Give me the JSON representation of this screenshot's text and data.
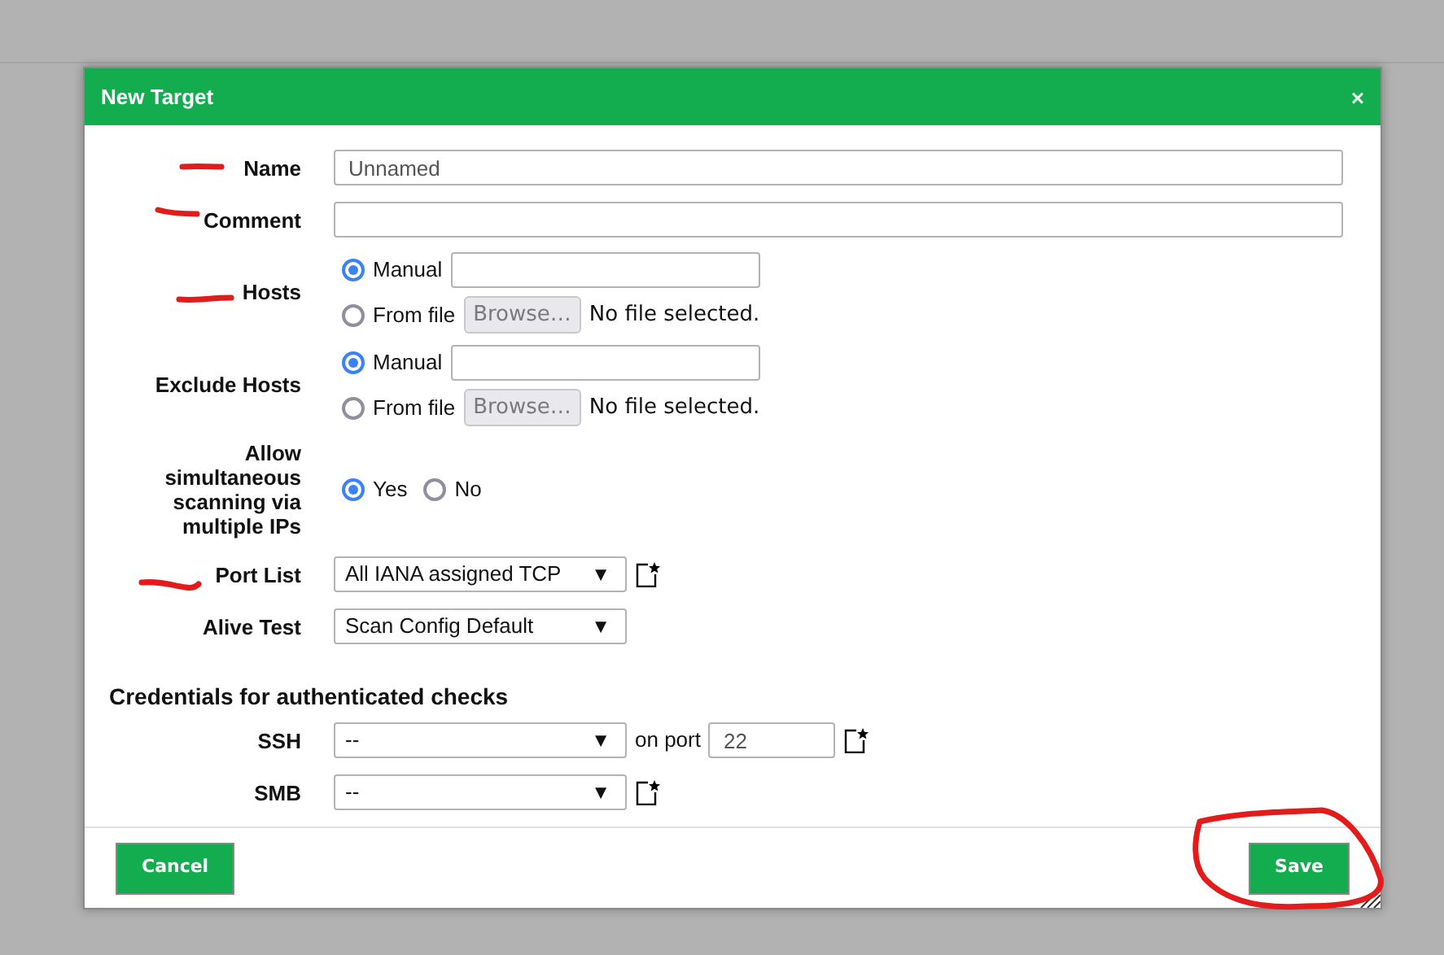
{
  "dialog": {
    "title": "New Target",
    "close": "×"
  },
  "rows": [
    {
      "kind": "text",
      "label": "Name",
      "value": "Unnamed"
    },
    {
      "kind": "text",
      "label": "Comment"
    },
    {
      "kind": "source",
      "label": "Hosts",
      "options": [
        {
          "label": "Manual",
          "selected": true,
          "kind": "input"
        },
        {
          "label": "From file",
          "selected": false,
          "kind": "file",
          "button": "Browse…",
          "status": "No file selected."
        }
      ]
    },
    {
      "kind": "source",
      "label": "Exclude Hosts",
      "options": [
        {
          "label": "Manual",
          "selected": true,
          "kind": "input"
        },
        {
          "label": "From file",
          "selected": false,
          "kind": "file",
          "button": "Browse…",
          "status": "No file selected."
        }
      ]
    },
    {
      "kind": "choice",
      "label": "Allow simultaneous scanning via multiple IPs",
      "options": [
        {
          "label": "Yes",
          "selected": true
        },
        {
          "label": "No",
          "selected": false
        }
      ]
    },
    {
      "kind": "select",
      "label": "Port List",
      "value": "All IANA assigned TCP",
      "caret": "▼",
      "new_icon": true
    },
    {
      "kind": "select",
      "label": "Alive Test",
      "value": "Scan Config Default",
      "caret": "▼",
      "new_icon": false
    }
  ],
  "credentials": {
    "heading": "Credentials for authenticated checks",
    "rows": [
      {
        "label": "SSH",
        "value": "--",
        "caret": "▼",
        "port_label": "on port",
        "port": "22"
      },
      {
        "label": "SMB",
        "value": "--",
        "caret": "▼"
      }
    ]
  },
  "footer": {
    "cancel": "Cancel",
    "save": "Save"
  }
}
